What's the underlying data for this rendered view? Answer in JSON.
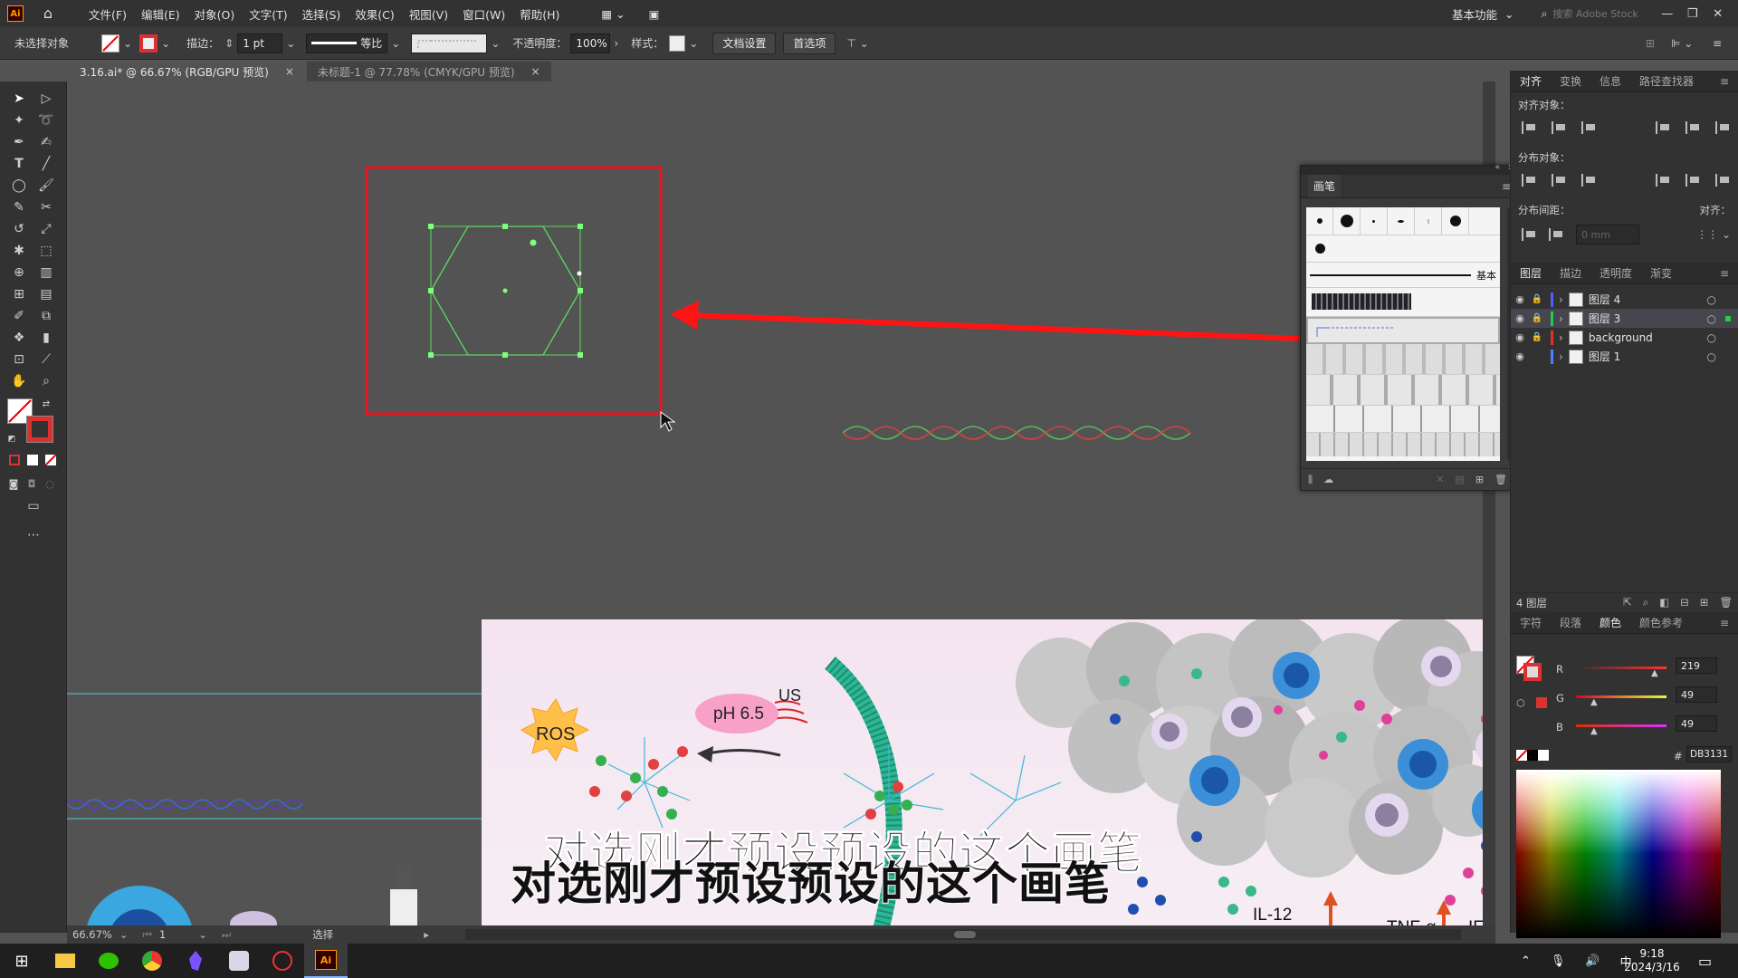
{
  "menubar": {
    "app_badge": "Ai",
    "items": [
      "文件(F)",
      "编辑(E)",
      "对象(O)",
      "文字(T)",
      "选择(S)",
      "效果(C)",
      "视图(V)",
      "窗口(W)",
      "帮助(H)"
    ],
    "workspace": "基本功能",
    "search_placeholder": "搜索 Adobe Stock"
  },
  "control": {
    "no_selection": "未选择对象",
    "stroke_label": "描边：",
    "stroke_value": "1 pt",
    "profile_label": "等比",
    "opacity_label": "不透明度：",
    "opacity_value": "100%",
    "style_label": "样式：",
    "doc_setup": "文档设置",
    "prefs": "首选项"
  },
  "tabs": [
    {
      "label": "3.16.ai* @ 66.67% (RGB/GPU 预览)",
      "active": true
    },
    {
      "label": "未标题-1 @ 77.78% (CMYK/GPU 预览)",
      "active": false
    }
  ],
  "align_panel": {
    "tabs": [
      "对齐",
      "变换",
      "信息",
      "路径查找器"
    ],
    "align_objects": "对齐对象：",
    "distribute_objects": "分布对象：",
    "distribute_spacing": "分布间距：",
    "align_to": "对齐：",
    "spacing_value": "0 mm"
  },
  "layers_panel": {
    "tabs": [
      "图层",
      "描边",
      "透明度",
      "渐变"
    ],
    "layers": [
      {
        "name": "图层 4",
        "color": "#4f5fff"
      },
      {
        "name": "图层 3",
        "color": "#29c94a"
      },
      {
        "name": "background",
        "color": "#e03030"
      },
      {
        "name": "图层 1",
        "color": "#4f7fff"
      }
    ],
    "count": "4 图层"
  },
  "color_panel": {
    "tabs": [
      "字符",
      "段落",
      "颜色",
      "颜色参考"
    ],
    "r_label": "R",
    "r_value": "219",
    "g_label": "G",
    "g_value": "49",
    "b_label": "B",
    "b_value": "49",
    "hex_prefix": "#",
    "hex": "DB3131"
  },
  "brush_panel": {
    "title": "画笔",
    "basic_label": "基本"
  },
  "artwork": {
    "ros": "ROS",
    "ph": "pH 6.5",
    "us": "US",
    "il12": "IL-12",
    "tnf": "TNF-α",
    "ifn": "IFN"
  },
  "subtitle": "对选刚才预设预设的这个画笔",
  "status": {
    "zoom": "66.67%",
    "page": "1",
    "tool": "选择"
  },
  "taskbar": {
    "time": "9:18",
    "date": "2024/3/16",
    "ime": "中"
  },
  "colors": {
    "selection_red": "#e8141e",
    "arrow_red": "#ff1414",
    "hexagon_green": "#5ed85e",
    "panel_bg": "#323232",
    "canvas_bg": "#535353"
  }
}
